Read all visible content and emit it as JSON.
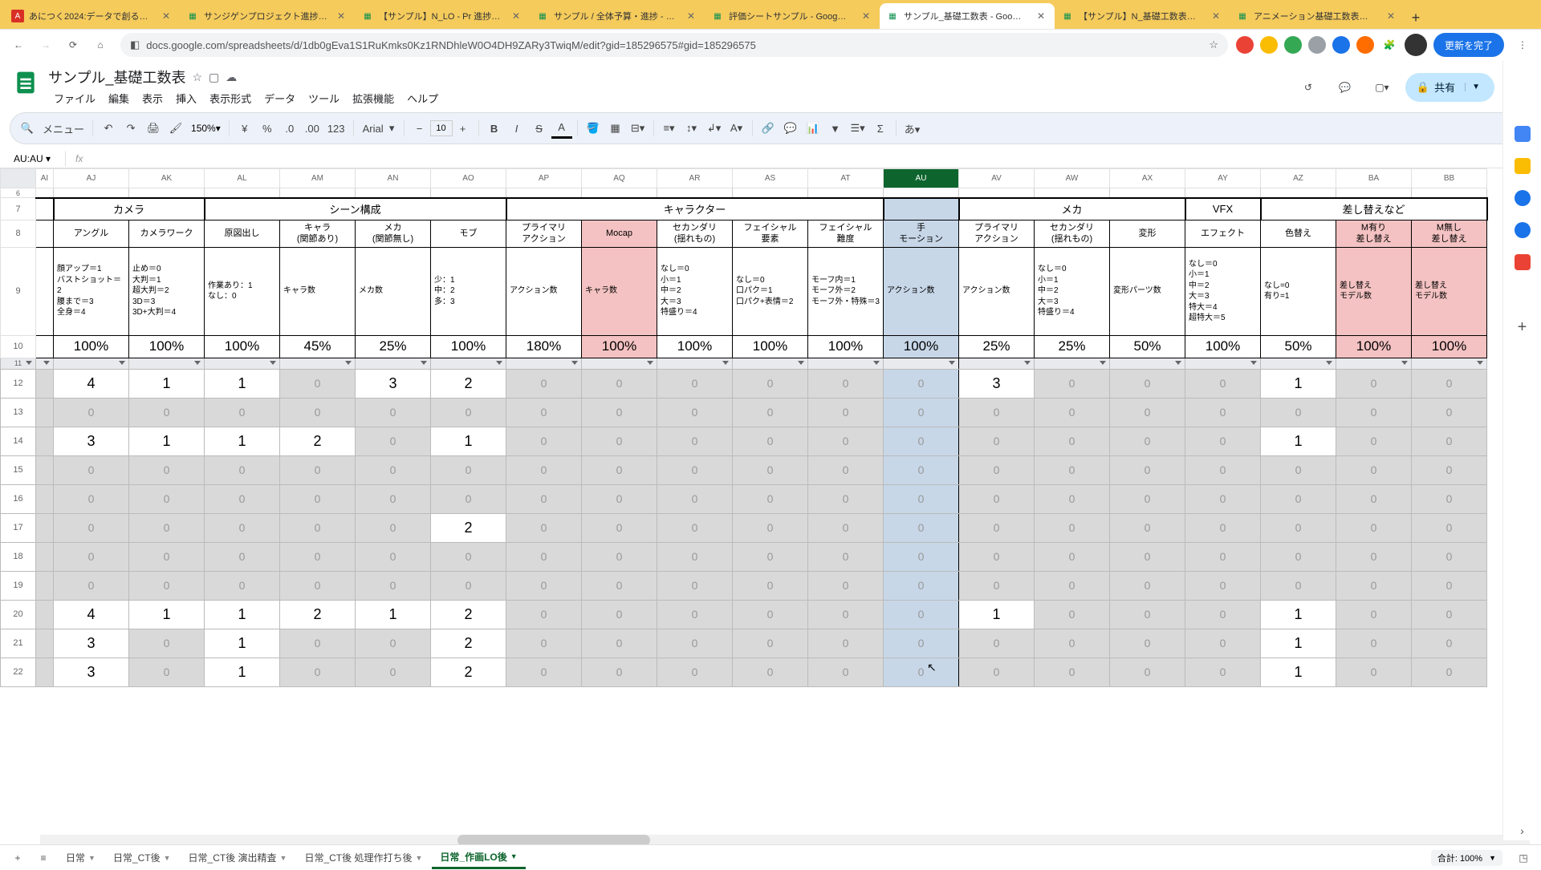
{
  "tabs": [
    {
      "favicon": "A",
      "label": "あにつく2024:データで創る…",
      "active": false
    },
    {
      "favicon": "sheets",
      "label": "サンジゲンプロジェクト進捗…",
      "active": false
    },
    {
      "favicon": "sheets",
      "label": "【サンプル】N_LO - Pr 進捗…",
      "active": false
    },
    {
      "favicon": "sheets",
      "label": "サンプル / 全体予算・進捗 - …",
      "active": false
    },
    {
      "favicon": "sheets",
      "label": "評価シートサンプル - Goog…",
      "active": false
    },
    {
      "favicon": "sheets",
      "label": "サンプル_基礎工数表 - Goo…",
      "active": true
    },
    {
      "favicon": "sheets",
      "label": "【サンプル】N_基礎工数表…",
      "active": false
    },
    {
      "favicon": "sheets",
      "label": "アニメーション基礎工数表…",
      "active": false
    }
  ],
  "url": "docs.google.com/spreadsheets/d/1db0gEva1S1RuKmks0Kz1RNDhleW0O4DH9ZARy3TwiqM/edit?gid=185296575#gid=185296575",
  "update_btn": "更新を完了",
  "doc_title": "サンプル_基礎工数表",
  "menus": [
    "ファイル",
    "編集",
    "表示",
    "挿入",
    "表示形式",
    "データ",
    "ツール",
    "拡張機能",
    "ヘルプ"
  ],
  "share_label": "共有",
  "toolbar": {
    "menu": "メニュー",
    "zoom": "150%",
    "font": "Arial",
    "size": "10",
    "fmt_123": "123",
    "fmt_00": ".0",
    "fmt_000": ".00"
  },
  "name_box": "AU:AU",
  "columns": [
    "AI",
    "AJ",
    "AK",
    "AL",
    "AM",
    "AN",
    "AO",
    "AP",
    "AQ",
    "AR",
    "AS",
    "AT",
    "AU",
    "AV",
    "AW",
    "AX",
    "AY",
    "AZ",
    "BA",
    "BB"
  ],
  "selected_col": "AU",
  "row_nums": [
    6,
    7,
    8,
    9,
    10,
    11,
    12,
    13,
    14,
    15,
    16,
    17,
    18,
    19,
    20,
    21,
    22
  ],
  "sections": {
    "camera": "カメラ",
    "scene": "シーン構成",
    "character": "キャラクター",
    "mecha": "メカ",
    "vfx": "VFX",
    "swap": "差し替えなど"
  },
  "subheads": [
    "アングル",
    "カメラワーク",
    "原図出し",
    "キャラ\n(関節あり)",
    "メカ\n(関節無し)",
    "モブ",
    "プライマリ\nアクション",
    "Mocap",
    "セカンダリ\n(揺れもの)",
    "フェイシャル\n要素",
    "フェイシャル\n難度",
    "手\nモーション",
    "プライマリ\nアクション",
    "セカンダリ\n(揺れもの)",
    "変形",
    "エフェクト",
    "色替え",
    "M有り\n差し替え",
    "M無し\n差し替え"
  ],
  "descs": [
    "顔アップ＝1\nバストショット＝2\n腰まで＝3\n全身＝4",
    "止め＝0\n大判＝1\n超大判＝2\n3D＝3\n3D+大判＝4",
    "作業あり：1\nなし：0",
    "キャラ数",
    "メカ数",
    "少：1\n中：2\n多：3",
    "アクション数",
    "キャラ数",
    "なし＝0\n小＝1\n中＝2\n大＝3\n特盛り＝4",
    "なし＝0\n口パク＝1\n口パク+表情＝2",
    "モーフ内＝1\nモーフ外＝2\nモーフ外・特殊＝3",
    "アクション数",
    "アクション数",
    "なし＝0\n小＝1\n中＝2\n大＝3\n特盛り＝4",
    "変形パーツ数",
    "なし＝0\n小＝1\n中＝2\n大＝3\n特大＝4\n超特大＝5",
    "なし=0\n有り=1",
    "差し替え\nモデル数",
    "差し替え\nモデル数"
  ],
  "pcts": [
    "100%",
    "100%",
    "100%",
    "45%",
    "25%",
    "100%",
    "180%",
    "100%",
    "100%",
    "100%",
    "100%",
    "100%",
    "25%",
    "25%",
    "50%",
    "100%",
    "50%",
    "100%",
    "100%"
  ],
  "data_rows": [
    {
      "r": 12,
      "vals": [
        "4",
        "1",
        "1",
        "0",
        "3",
        "2",
        "0",
        "0",
        "0",
        "0",
        "0",
        "0",
        "3",
        "0",
        "0",
        "0",
        "1",
        "0",
        "0"
      ],
      "mask": [
        1,
        1,
        1,
        0,
        1,
        1,
        0,
        0,
        0,
        0,
        0,
        0,
        1,
        0,
        0,
        0,
        1,
        0,
        0
      ]
    },
    {
      "r": 13,
      "vals": [
        "0",
        "0",
        "0",
        "0",
        "0",
        "0",
        "0",
        "0",
        "0",
        "0",
        "0",
        "0",
        "0",
        "0",
        "0",
        "0",
        "0",
        "0",
        "0"
      ],
      "mask": [
        0,
        0,
        0,
        0,
        0,
        0,
        0,
        0,
        0,
        0,
        0,
        0,
        0,
        0,
        0,
        0,
        0,
        0,
        0
      ]
    },
    {
      "r": 14,
      "vals": [
        "3",
        "1",
        "1",
        "2",
        "0",
        "1",
        "0",
        "0",
        "0",
        "0",
        "0",
        "0",
        "0",
        "0",
        "0",
        "0",
        "1",
        "0",
        "0"
      ],
      "mask": [
        1,
        1,
        1,
        1,
        0,
        1,
        0,
        0,
        0,
        0,
        0,
        0,
        0,
        0,
        0,
        0,
        1,
        0,
        0
      ]
    },
    {
      "r": 15,
      "vals": [
        "0",
        "0",
        "0",
        "0",
        "0",
        "0",
        "0",
        "0",
        "0",
        "0",
        "0",
        "0",
        "0",
        "0",
        "0",
        "0",
        "0",
        "0",
        "0"
      ],
      "mask": [
        0,
        0,
        0,
        0,
        0,
        0,
        0,
        0,
        0,
        0,
        0,
        0,
        0,
        0,
        0,
        0,
        0,
        0,
        0
      ]
    },
    {
      "r": 16,
      "vals": [
        "0",
        "0",
        "0",
        "0",
        "0",
        "0",
        "0",
        "0",
        "0",
        "0",
        "0",
        "0",
        "0",
        "0",
        "0",
        "0",
        "0",
        "0",
        "0"
      ],
      "mask": [
        0,
        0,
        0,
        0,
        0,
        0,
        0,
        0,
        0,
        0,
        0,
        0,
        0,
        0,
        0,
        0,
        0,
        0,
        0
      ]
    },
    {
      "r": 17,
      "vals": [
        "0",
        "0",
        "0",
        "0",
        "0",
        "2",
        "0",
        "0",
        "0",
        "0",
        "0",
        "0",
        "0",
        "0",
        "0",
        "0",
        "0",
        "0",
        "0"
      ],
      "mask": [
        0,
        0,
        0,
        0,
        0,
        1,
        0,
        0,
        0,
        0,
        0,
        0,
        0,
        0,
        0,
        0,
        0,
        0,
        0
      ]
    },
    {
      "r": 18,
      "vals": [
        "0",
        "0",
        "0",
        "0",
        "0",
        "0",
        "0",
        "0",
        "0",
        "0",
        "0",
        "0",
        "0",
        "0",
        "0",
        "0",
        "0",
        "0",
        "0"
      ],
      "mask": [
        0,
        0,
        0,
        0,
        0,
        0,
        0,
        0,
        0,
        0,
        0,
        0,
        0,
        0,
        0,
        0,
        0,
        0,
        0
      ]
    },
    {
      "r": 19,
      "vals": [
        "0",
        "0",
        "0",
        "0",
        "0",
        "0",
        "0",
        "0",
        "0",
        "0",
        "0",
        "0",
        "0",
        "0",
        "0",
        "0",
        "0",
        "0",
        "0"
      ],
      "mask": [
        0,
        0,
        0,
        0,
        0,
        0,
        0,
        0,
        0,
        0,
        0,
        0,
        0,
        0,
        0,
        0,
        0,
        0,
        0
      ]
    },
    {
      "r": 20,
      "vals": [
        "4",
        "1",
        "1",
        "2",
        "1",
        "2",
        "0",
        "0",
        "0",
        "0",
        "0",
        "0",
        "1",
        "0",
        "0",
        "0",
        "1",
        "0",
        "0"
      ],
      "mask": [
        1,
        1,
        1,
        1,
        1,
        1,
        0,
        0,
        0,
        0,
        0,
        0,
        1,
        0,
        0,
        0,
        1,
        0,
        0
      ]
    },
    {
      "r": 21,
      "vals": [
        "3",
        "0",
        "1",
        "0",
        "0",
        "2",
        "0",
        "0",
        "0",
        "0",
        "0",
        "0",
        "0",
        "0",
        "0",
        "0",
        "1",
        "0",
        "0"
      ],
      "mask": [
        1,
        0,
        1,
        0,
        0,
        1,
        0,
        0,
        0,
        0,
        0,
        0,
        0,
        0,
        0,
        0,
        1,
        0,
        0
      ]
    },
    {
      "r": 22,
      "vals": [
        "3",
        "0",
        "1",
        "0",
        "0",
        "2",
        "0",
        "0",
        "0",
        "0",
        "0",
        "0",
        "0",
        "0",
        "0",
        "0",
        "1",
        "0",
        "0"
      ],
      "mask": [
        1,
        0,
        1,
        0,
        0,
        1,
        0,
        0,
        0,
        0,
        0,
        0,
        0,
        0,
        0,
        0,
        1,
        0,
        0
      ]
    }
  ],
  "sheet_tabs": [
    {
      "label": "日常",
      "active": false
    },
    {
      "label": "日常_CT後",
      "active": false
    },
    {
      "label": "日常_CT後 演出精査",
      "active": false
    },
    {
      "label": "日常_CT後 処理作打ち後",
      "active": false
    },
    {
      "label": "日常_作画LO後",
      "active": true
    }
  ],
  "status": "合計: 100%"
}
